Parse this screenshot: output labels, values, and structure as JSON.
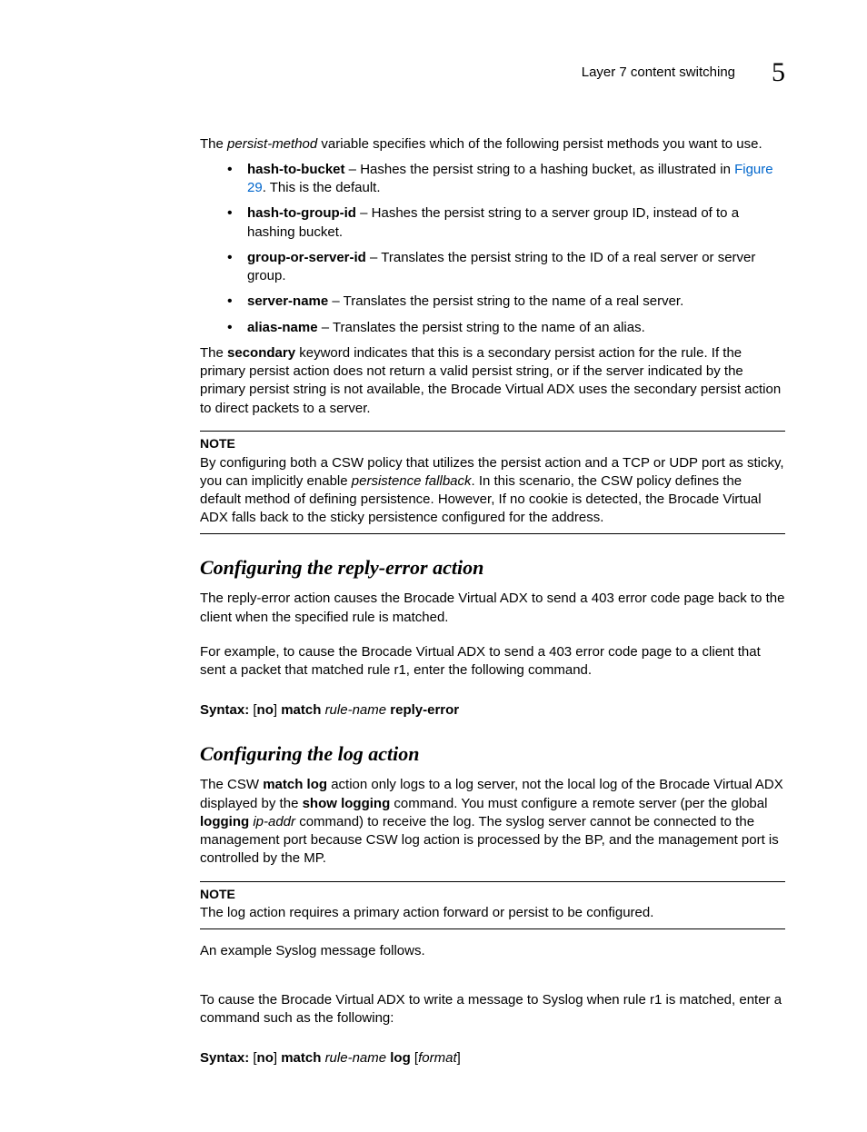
{
  "header": {
    "title": "Layer 7 content switching",
    "chapter": "5"
  },
  "intro": {
    "prefix": "The ",
    "var": "persist-method",
    "suffix": " variable specifies which of the following persist methods you want to use."
  },
  "bullets": [
    {
      "term": "hash-to-bucket",
      "desc_pre": " – Hashes the persist string to a hashing bucket, as illustrated in ",
      "link": "Figure 29",
      "desc_post": ". This is the default."
    },
    {
      "term": "hash-to-group-id",
      "desc": " – Hashes the persist string to a server group ID, instead of to a hashing bucket."
    },
    {
      "term": "group-or-server-id",
      "desc": " – Translates the persist string to the ID of a real server or server group."
    },
    {
      "term": "server-name",
      "desc": " – Translates the persist string to the name of a real server."
    },
    {
      "term": "alias-name",
      "desc": " – Translates the persist string to the name of an alias."
    }
  ],
  "secondary": {
    "pre": "The ",
    "kw": "secondary",
    "post": " keyword indicates that this is a secondary persist action for the rule. If the primary persist action does not return a valid persist string, or if the server indicated by the primary persist string is not available, the Brocade Virtual ADX uses the secondary persist action to direct packets to a server."
  },
  "note1": {
    "label": "NOTE",
    "body_pre": "By configuring both a CSW policy that utilizes the persist action and a TCP or UDP port as sticky, you can implicitly enable ",
    "body_it": "persistence fallback",
    "body_post": ". In this scenario, the CSW policy defines the default method of defining persistence. However, If no cookie is detected, the Brocade Virtual ADX falls back to the sticky persistence configured for the address."
  },
  "sec_reply": {
    "heading": "Configuring the reply-error action",
    "p1": "The reply-error action causes the Brocade Virtual ADX to send a 403 error code page back to the client when the specified rule is matched.",
    "p2": "For example, to cause the Brocade Virtual ADX to send a 403 error code page to a client that sent a packet that matched rule r1, enter the following command.",
    "syntax": {
      "label": "Syntax: ",
      "p1": " [",
      "no": "no",
      "p2": "] ",
      "match": "match",
      "sp": " ",
      "var": "rule-name",
      "tail": " reply-error"
    }
  },
  "sec_log": {
    "heading": "Configuring the log action",
    "p1": {
      "a": "The CSW ",
      "b": "match log",
      "c": " action only logs to a log server, not the local log of the Brocade Virtual ADX displayed by the ",
      "d": "show logging",
      "e": " command. You must configure a remote server (per the global ",
      "f": "logging",
      "g": " ",
      "h": "ip-addr",
      "i": " command) to receive the log. The syslog server cannot be connected to the management port because CSW log action is processed by the BP, and the management port is controlled by the MP."
    },
    "note": {
      "label": "NOTE",
      "body": "The log action requires a primary action forward or persist to be configured."
    },
    "p2": "An example Syslog message follows.",
    "p3": "To cause the Brocade Virtual ADX to write a message to Syslog when rule r1 is matched, enter a command such as the following:",
    "syntax": {
      "label": "Syntax: ",
      "p1": " [",
      "no": "no",
      "p2": "] ",
      "match": "match",
      "sp": " ",
      "var": "rule-name",
      "mid": " log",
      "sp2": " [",
      "var2": "format",
      "tail": "]"
    }
  }
}
